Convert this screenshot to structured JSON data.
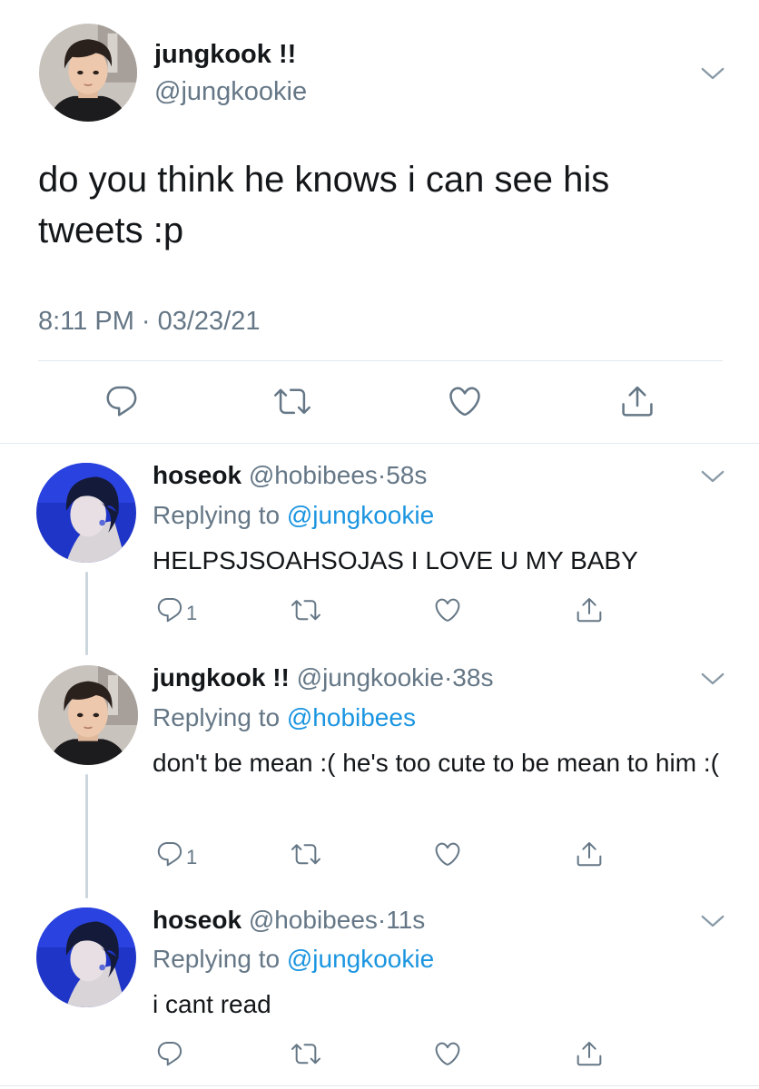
{
  "main_tweet": {
    "display_name": "jungkook !!",
    "handle": "@jungkookie",
    "text": "do you think he knows i can see his tweets :p",
    "timestamp": "8:11 PM · 03/23/21"
  },
  "replies": [
    {
      "display_name": "hoseok",
      "handle": "@hobibees",
      "dot": "·",
      "time": "58s",
      "replying_prefix": "Replying to",
      "replying_to": "@jungkookie",
      "text": "HELPSJSOAHSOJAS I LOVE U MY BABY",
      "reply_count": "1"
    },
    {
      "display_name": "jungkook !!",
      "handle": "@jungkookie",
      "dot": "·",
      "time": "38s",
      "replying_prefix": "Replying to",
      "replying_to": "@hobibees",
      "text": "don't be mean :( he's too cute to be mean to him :(",
      "reply_count": "1"
    },
    {
      "display_name": "hoseok",
      "handle": "@hobibees",
      "dot": "·",
      "time": "11s",
      "replying_prefix": "Replying to",
      "replying_to": "@jungkookie",
      "text": "i cant read",
      "reply_count": ""
    }
  ],
  "icons": {
    "reply": "reply-icon",
    "retweet": "retweet-icon",
    "like": "like-icon",
    "share": "share-icon",
    "menu": "chevron-down-icon"
  },
  "colors": {
    "text": "#14171a",
    "secondary": "#657786",
    "link": "#1b95e0",
    "divider": "#e1e8ed"
  }
}
